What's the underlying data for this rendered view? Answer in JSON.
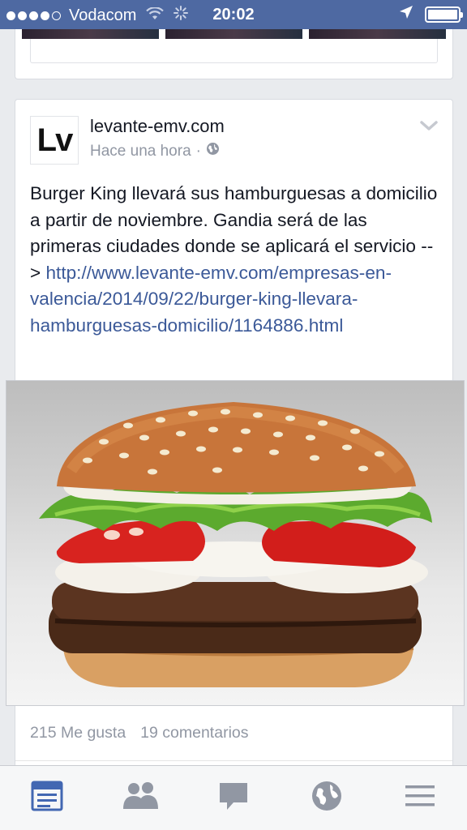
{
  "status_bar": {
    "carrier": "Vodacom",
    "time": "20:02"
  },
  "post": {
    "page_logo_text": "Lv",
    "page_name": "levante-emv.com",
    "time_ago": "Hace una hora",
    "separator": "·",
    "text": "Burger King llevará sus hamburguesas a domicilio a partir de noviembre. Gandia será de las primeras ciudades donde se aplicará el servicio --> ",
    "link": "http://www.levante-emv.com/empresas-en-valencia/2014/09/22/burger-king-llevara-hamburguesas-domicilio/1164886.html",
    "likes": "215 Me gusta",
    "comments": "19 comentarios"
  },
  "tabbar": {
    "active_color": "#4267b2",
    "inactive_color": "#9197a3",
    "tabs": [
      "news-feed-icon",
      "friends-icon",
      "messages-icon",
      "globe-icon",
      "menu-icon"
    ]
  }
}
